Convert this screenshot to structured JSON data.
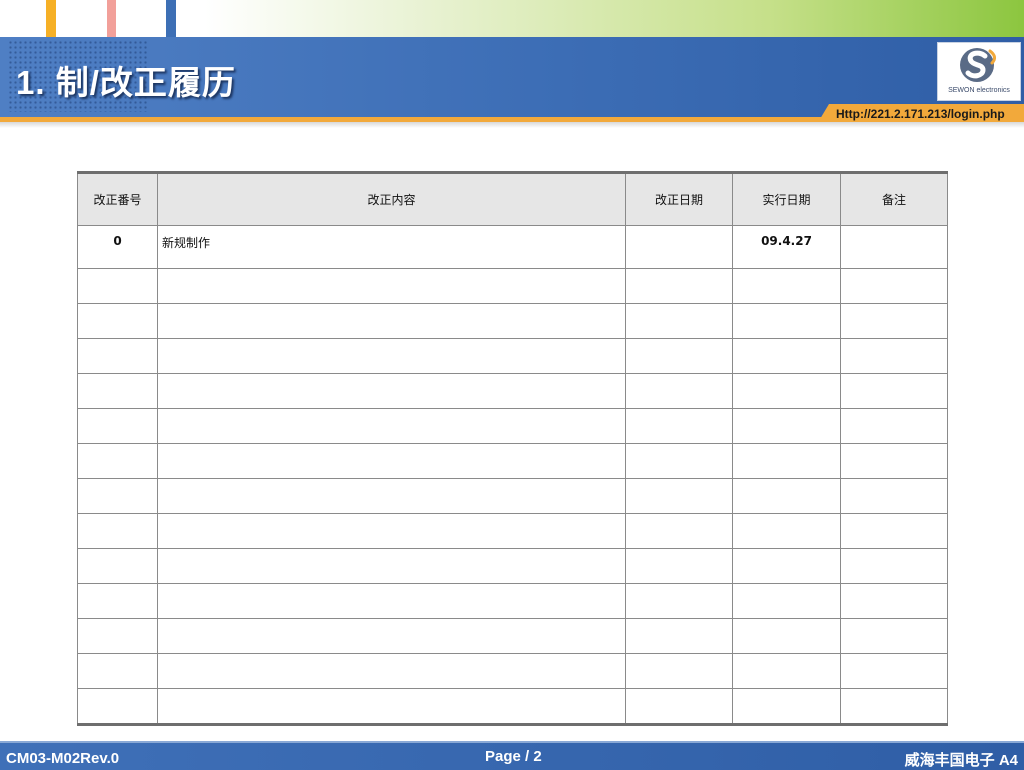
{
  "header": {
    "title": "1. 制/改正履历",
    "url": "Http://221.2.171.213/login.php",
    "logo_text": "SEWON electronics"
  },
  "colors": {
    "header_blue": "#3c6db5",
    "accent_orange": "#f2a93b",
    "accent_green": "#8cc63f"
  },
  "table": {
    "headers": [
      "改正番号",
      "改正内容",
      "改正日期",
      "实行日期",
      "备注"
    ],
    "rows": [
      {
        "no": "0",
        "content": "新规制作",
        "date": "",
        "exec": "09.4.27",
        "note": ""
      },
      {
        "no": "",
        "content": "",
        "date": "",
        "exec": "",
        "note": ""
      },
      {
        "no": "",
        "content": "",
        "date": "",
        "exec": "",
        "note": ""
      },
      {
        "no": "",
        "content": "",
        "date": "",
        "exec": "",
        "note": ""
      },
      {
        "no": "",
        "content": "",
        "date": "",
        "exec": "",
        "note": ""
      },
      {
        "no": "",
        "content": "",
        "date": "",
        "exec": "",
        "note": ""
      },
      {
        "no": "",
        "content": "",
        "date": "",
        "exec": "",
        "note": ""
      },
      {
        "no": "",
        "content": "",
        "date": "",
        "exec": "",
        "note": ""
      },
      {
        "no": "",
        "content": "",
        "date": "",
        "exec": "",
        "note": ""
      },
      {
        "no": "",
        "content": "",
        "date": "",
        "exec": "",
        "note": ""
      },
      {
        "no": "",
        "content": "",
        "date": "",
        "exec": "",
        "note": ""
      },
      {
        "no": "",
        "content": "",
        "date": "",
        "exec": "",
        "note": ""
      },
      {
        "no": "",
        "content": "",
        "date": "",
        "exec": "",
        "note": ""
      },
      {
        "no": "",
        "content": "",
        "date": "",
        "exec": "",
        "note": ""
      }
    ]
  },
  "footer": {
    "doc_code": "CM03-M02Rev.0",
    "page_label": "Page / 2",
    "company": "威海丰国电子 A4"
  }
}
